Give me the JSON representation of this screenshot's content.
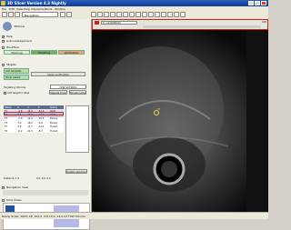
{
  "window": {
    "title": "3D Slicer Version 4.3 Nightly"
  },
  "menu": [
    "File",
    "Edit",
    "View",
    "Help",
    "Interactors",
    "Tools",
    "Window"
  ],
  "module": {
    "name": "Navigation",
    "logo_text": "3DSlicer"
  },
  "sections": {
    "help": "Help",
    "acknowledgement": "Acknowledgement",
    "workflow": "Workflow",
    "steps": "Steps",
    "targets": "Targets",
    "navigation_view": "Navigation View",
    "slice_view": "Slice Views"
  },
  "tabs": {
    "planning": "Planning",
    "targeting": "Targeting",
    "verification": "Verification"
  },
  "targets": {
    "template_label": "Add template",
    "show_label": "Show Labels",
    "show_verif": "Show verification",
    "targeting_volume_label": "Targeting Volume",
    "targeting_volume_value": "T2W SCT0001",
    "add_target_label": "Add target to label",
    "needle_type": "Needle type",
    "target_name": "Target name",
    "delete_label": "Delete selected target",
    "columns": [
      "Name",
      "R",
      "A",
      "S",
      "Status"
    ],
    "rows": [
      [
        "T1",
        "-4.8",
        "15.9",
        "-12.0",
        "Valid"
      ],
      [
        "T2",
        "5.1",
        "14.3",
        "-12.0",
        "Valid"
      ],
      [
        "T3",
        "-2.8",
        "12.0",
        "-16.2",
        "Biopsy"
      ],
      [
        "T4",
        "3.9",
        "18.2",
        "-9.8",
        "Biopsy"
      ],
      [
        "T5",
        "0.6",
        "11.7",
        "-14.4",
        "Transit"
      ],
      [
        "T6",
        "-6.2",
        "21.5",
        "-8.3",
        "Transit"
      ]
    ],
    "distance_label": "Distance: 1.0",
    "position_label": "0.0, 0.0, 0.0"
  },
  "viewer": {
    "slice_label": "S: -12.0000mm",
    "zoom": "100"
  },
  "status": {
    "text": "Ready  Scale: 100%  SP: 100.0  -4.8 15.9 -12.0  Inf T2W Volume"
  },
  "colors": {
    "accent": "#d02020",
    "header": "#5a6b8c"
  }
}
